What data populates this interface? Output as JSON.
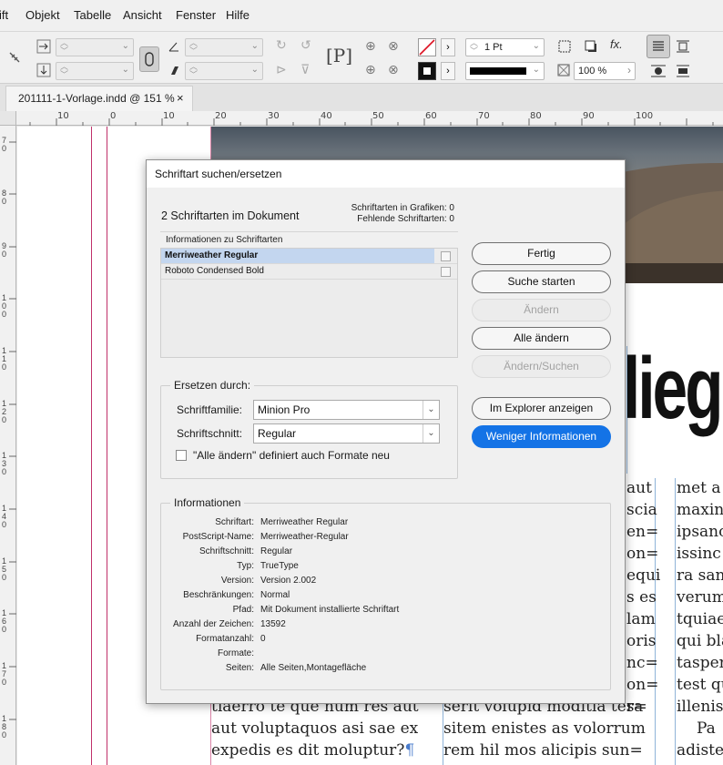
{
  "menu": {
    "items": [
      "ift",
      "Objekt",
      "Tabelle",
      "Ansicht",
      "Fenster",
      "Hilfe"
    ]
  },
  "controlbar": {
    "stroke_weight": "1 Pt",
    "zoom_field": "100 %"
  },
  "tab": {
    "title": "201111-1-Vorlage.indd @ 151 %",
    "close": "×"
  },
  "ruler": {
    "h_numbers": [
      "10",
      "0",
      "10",
      "20",
      "30",
      "40",
      "50",
      "60",
      "70",
      "80",
      "90",
      "100"
    ],
    "v_numbers": [
      "7 0",
      "8 0",
      "9 0",
      "1 0 0",
      "1 1 0",
      "1 2 0",
      "1 3 0",
      "1 4 0",
      "1 5 0",
      "1 6 0",
      "1 7 0",
      "1 8 0"
    ]
  },
  "document": {
    "headline_fragment": "lieg",
    "col1_lines": [
      "tiaerro te que num res aut",
      "aut voluptaquos asi sae ex",
      "expedis es dit moluptur?"
    ],
    "col2_lines": [
      "aut",
      "scia",
      "en=",
      "on=",
      "equi",
      "s es",
      "lam",
      "oris",
      "nc=",
      "on=",
      "ra",
      "serit volupid moditia tes=",
      "sitem enistes as volorrum",
      "rem hil mos alicipis sun="
    ],
    "col3_lines": [
      "met a",
      "maxin",
      "ipsanc",
      "issinc",
      "ra san",
      "verum",
      "tquiae",
      "qui bla",
      "tasper",
      "test qu",
      "illenis",
      "Pa",
      "adiste"
    ],
    "pilcrow": "¶"
  },
  "dialog": {
    "title": "Schriftart suchen/ersetzen",
    "font_count": "2 Schriftarten im Dokument",
    "fonts_in_graphics": "Schriftarten in Grafiken: 0",
    "missing_fonts": "Fehlende Schriftarten: 0",
    "list_header": "Informationen zu Schriftarten",
    "fonts": [
      {
        "name": "Merriweather Regular",
        "selected": true
      },
      {
        "name": "Roboto Condensed Bold",
        "selected": false
      }
    ],
    "buttons": {
      "done": "Fertig",
      "find_first": "Suche starten",
      "change": "Ändern",
      "change_all": "Alle ändern",
      "change_find": "Ändern/Suchen",
      "reveal_explorer": "Im Explorer anzeigen",
      "less_info": "Weniger Informationen"
    },
    "replace": {
      "title": "Ersetzen durch:",
      "family_label": "Schriftfamilie:",
      "family_value": "Minion Pro",
      "style_label": "Schriftschnitt:",
      "style_value": "Regular",
      "redefine_label": "\"Alle ändern\" definiert auch Formate neu",
      "redefine_checked": false
    },
    "info": {
      "title": "Informationen",
      "rows": [
        {
          "label": "Schriftart:",
          "value": "Merriweather Regular"
        },
        {
          "label": "PostScript-Name:",
          "value": "Merriweather-Regular"
        },
        {
          "label": "Schriftschnitt:",
          "value": "Regular"
        },
        {
          "label": "Typ:",
          "value": "TrueType"
        },
        {
          "label": "Version:",
          "value": "Version 2.002"
        },
        {
          "label": "Beschränkungen:",
          "value": "Normal"
        },
        {
          "label": "Pfad:",
          "value": "Mit Dokument installierte Schriftart"
        },
        {
          "label": "Anzahl der Zeichen:",
          "value": "13592"
        },
        {
          "label": "Formatanzahl:",
          "value": "0"
        },
        {
          "label": "Formate:",
          "value": ""
        },
        {
          "label": "Seiten:",
          "value": "Alle Seiten,Montagefläche"
        }
      ]
    }
  },
  "colors": {
    "primary_button": "#1473e6",
    "selection": "#c3d6ef",
    "margin_guide": "#c0306a",
    "column_guide": "#8fb3d8"
  }
}
